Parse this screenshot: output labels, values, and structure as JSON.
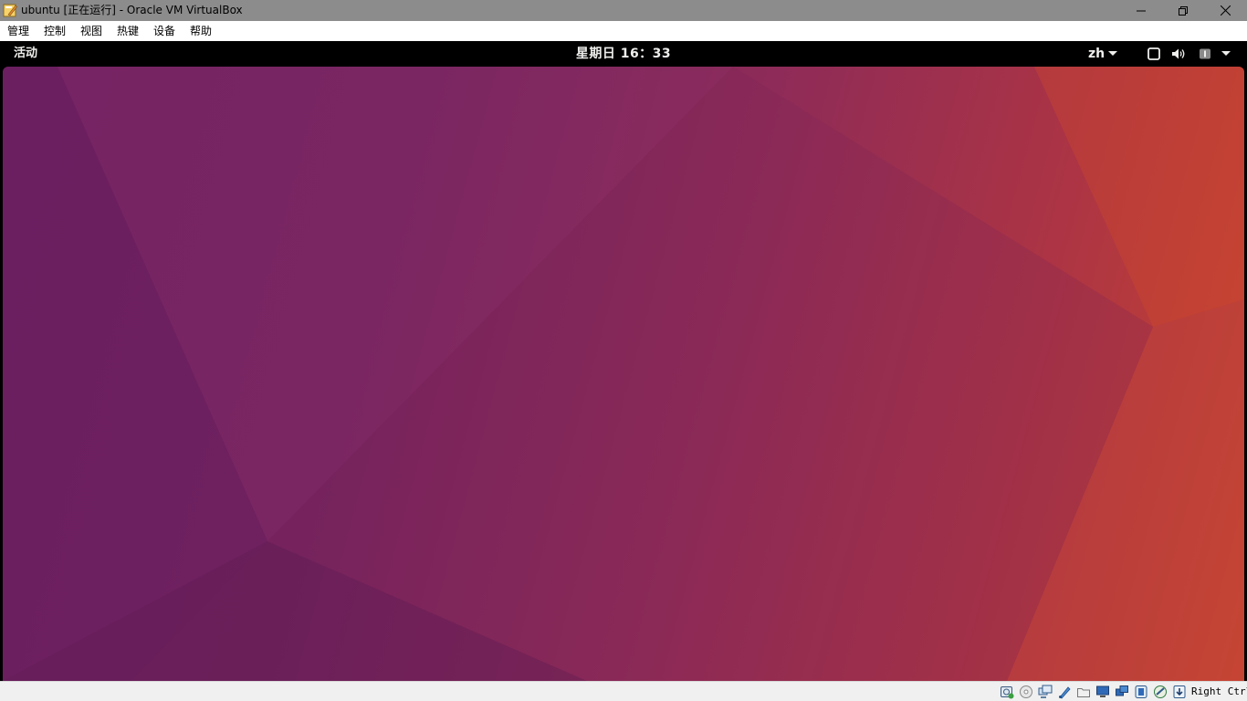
{
  "window": {
    "title": "ubuntu [正在运行] - Oracle VM VirtualBox",
    "icon": "virtualbox-app-icon"
  },
  "menubar": {
    "items": [
      "管理",
      "控制",
      "视图",
      "热键",
      "设备",
      "帮助"
    ]
  },
  "guest": {
    "topbar": {
      "activities": "活动",
      "clock": "星期日 16：33",
      "language": "zh"
    }
  },
  "statusbar": {
    "icons": [
      "hard-disk-icon",
      "optical-disk-icon",
      "audio-icon",
      "network-icon",
      "usb-icon",
      "shared-folders-icon",
      "display-icon",
      "video-capture-icon",
      "cpu-virtualization-icon",
      "mouse-integration-icon",
      "keyboard-capture-icon"
    ],
    "host_key": "Right Ctrl"
  },
  "colors": {
    "wallpaper_left": "#6e2062",
    "wallpaper_right": "#c8452f",
    "topbar_bg": "#000000",
    "titlebar_bg": "#8c8c8c"
  }
}
